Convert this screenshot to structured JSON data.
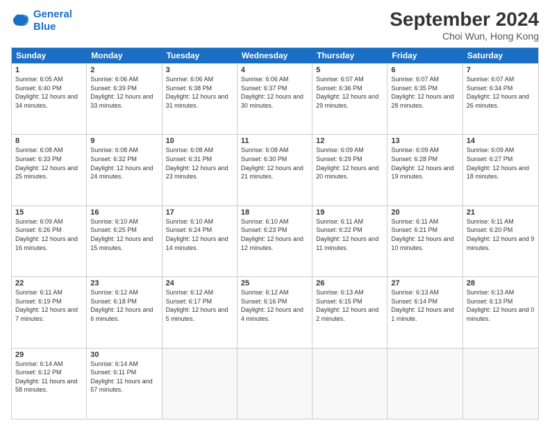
{
  "header": {
    "logo_line1": "General",
    "logo_line2": "Blue",
    "month": "September 2024",
    "location": "Choi Wun, Hong Kong"
  },
  "days": [
    "Sunday",
    "Monday",
    "Tuesday",
    "Wednesday",
    "Thursday",
    "Friday",
    "Saturday"
  ],
  "weeks": [
    [
      {
        "day": 1,
        "sunrise": "6:05 AM",
        "sunset": "6:40 PM",
        "daylight": "12 hours and 34 minutes."
      },
      {
        "day": 2,
        "sunrise": "6:06 AM",
        "sunset": "6:39 PM",
        "daylight": "12 hours and 33 minutes."
      },
      {
        "day": 3,
        "sunrise": "6:06 AM",
        "sunset": "6:38 PM",
        "daylight": "12 hours and 31 minutes."
      },
      {
        "day": 4,
        "sunrise": "6:06 AM",
        "sunset": "6:37 PM",
        "daylight": "12 hours and 30 minutes."
      },
      {
        "day": 5,
        "sunrise": "6:07 AM",
        "sunset": "6:36 PM",
        "daylight": "12 hours and 29 minutes."
      },
      {
        "day": 6,
        "sunrise": "6:07 AM",
        "sunset": "6:35 PM",
        "daylight": "12 hours and 28 minutes."
      },
      {
        "day": 7,
        "sunrise": "6:07 AM",
        "sunset": "6:34 PM",
        "daylight": "12 hours and 26 minutes."
      }
    ],
    [
      {
        "day": 8,
        "sunrise": "6:08 AM",
        "sunset": "6:33 PM",
        "daylight": "12 hours and 25 minutes."
      },
      {
        "day": 9,
        "sunrise": "6:08 AM",
        "sunset": "6:32 PM",
        "daylight": "12 hours and 24 minutes."
      },
      {
        "day": 10,
        "sunrise": "6:08 AM",
        "sunset": "6:31 PM",
        "daylight": "12 hours and 23 minutes."
      },
      {
        "day": 11,
        "sunrise": "6:08 AM",
        "sunset": "6:30 PM",
        "daylight": "12 hours and 21 minutes."
      },
      {
        "day": 12,
        "sunrise": "6:09 AM",
        "sunset": "6:29 PM",
        "daylight": "12 hours and 20 minutes."
      },
      {
        "day": 13,
        "sunrise": "6:09 AM",
        "sunset": "6:28 PM",
        "daylight": "12 hours and 19 minutes."
      },
      {
        "day": 14,
        "sunrise": "6:09 AM",
        "sunset": "6:27 PM",
        "daylight": "12 hours and 18 minutes."
      }
    ],
    [
      {
        "day": 15,
        "sunrise": "6:09 AM",
        "sunset": "6:26 PM",
        "daylight": "12 hours and 16 minutes."
      },
      {
        "day": 16,
        "sunrise": "6:10 AM",
        "sunset": "6:25 PM",
        "daylight": "12 hours and 15 minutes."
      },
      {
        "day": 17,
        "sunrise": "6:10 AM",
        "sunset": "6:24 PM",
        "daylight": "12 hours and 14 minutes."
      },
      {
        "day": 18,
        "sunrise": "6:10 AM",
        "sunset": "6:23 PM",
        "daylight": "12 hours and 12 minutes."
      },
      {
        "day": 19,
        "sunrise": "6:11 AM",
        "sunset": "6:22 PM",
        "daylight": "12 hours and 11 minutes."
      },
      {
        "day": 20,
        "sunrise": "6:11 AM",
        "sunset": "6:21 PM",
        "daylight": "12 hours and 10 minutes."
      },
      {
        "day": 21,
        "sunrise": "6:11 AM",
        "sunset": "6:20 PM",
        "daylight": "12 hours and 9 minutes."
      }
    ],
    [
      {
        "day": 22,
        "sunrise": "6:11 AM",
        "sunset": "6:19 PM",
        "daylight": "12 hours and 7 minutes."
      },
      {
        "day": 23,
        "sunrise": "6:12 AM",
        "sunset": "6:18 PM",
        "daylight": "12 hours and 6 minutes."
      },
      {
        "day": 24,
        "sunrise": "6:12 AM",
        "sunset": "6:17 PM",
        "daylight": "12 hours and 5 minutes."
      },
      {
        "day": 25,
        "sunrise": "6:12 AM",
        "sunset": "6:16 PM",
        "daylight": "12 hours and 4 minutes."
      },
      {
        "day": 26,
        "sunrise": "6:13 AM",
        "sunset": "6:15 PM",
        "daylight": "12 hours and 2 minutes."
      },
      {
        "day": 27,
        "sunrise": "6:13 AM",
        "sunset": "6:14 PM",
        "daylight": "12 hours and 1 minute."
      },
      {
        "day": 28,
        "sunrise": "6:13 AM",
        "sunset": "6:13 PM",
        "daylight": "12 hours and 0 minutes."
      }
    ],
    [
      {
        "day": 29,
        "sunrise": "6:14 AM",
        "sunset": "6:12 PM",
        "daylight": "11 hours and 58 minutes."
      },
      {
        "day": 30,
        "sunrise": "6:14 AM",
        "sunset": "6:11 PM",
        "daylight": "11 hours and 57 minutes."
      },
      null,
      null,
      null,
      null,
      null
    ]
  ]
}
